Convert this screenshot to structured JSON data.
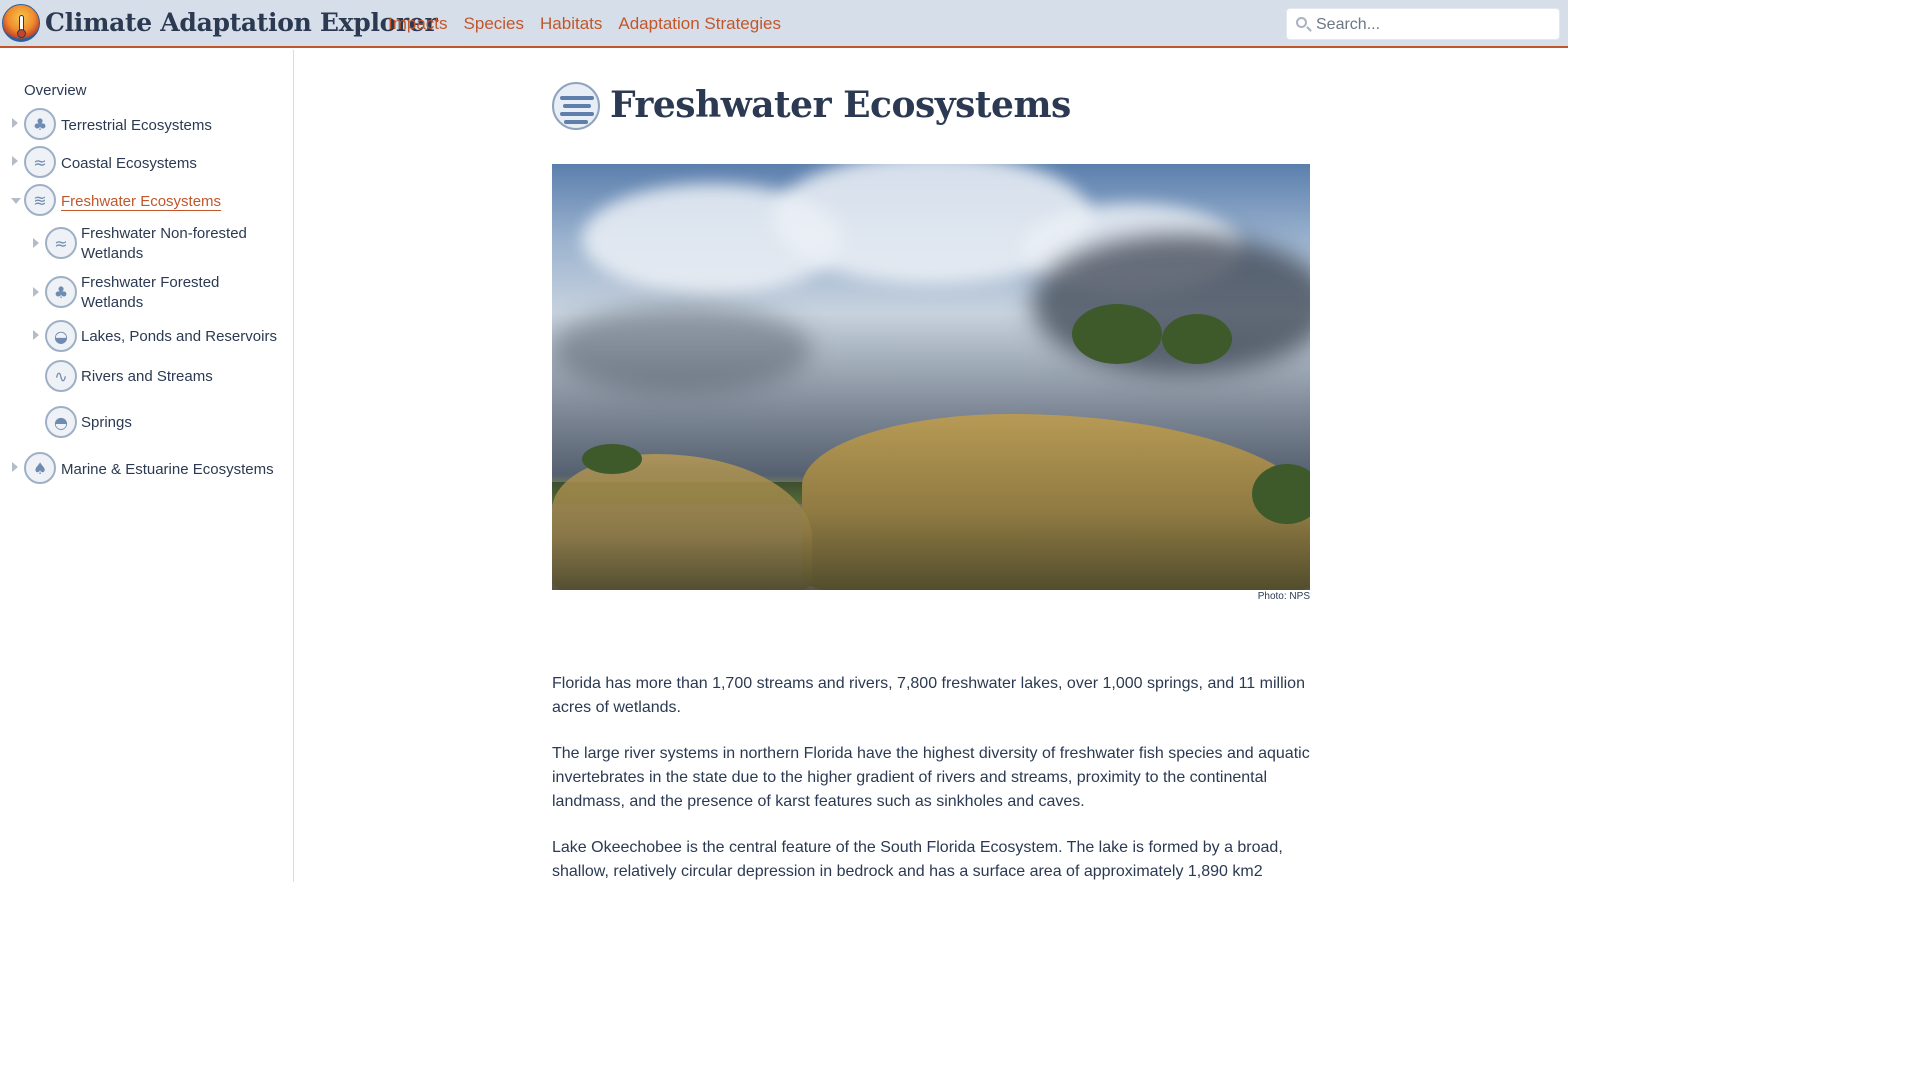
{
  "header": {
    "app_title": "Climate Adaptation Explorer",
    "nav": [
      "Impacts",
      "Species",
      "Habitats",
      "Adaptation Strategies"
    ],
    "search_placeholder": "Search..."
  },
  "sidebar": {
    "overview": "Overview",
    "items": [
      {
        "label": "Terrestrial Ecosystems",
        "icon": "tree-icon",
        "expandable": true,
        "expanded": false,
        "active": false
      },
      {
        "label": "Coastal Ecosystems",
        "icon": "coast-icon",
        "expandable": true,
        "expanded": false,
        "active": false
      },
      {
        "label": "Freshwater Ecosystems",
        "icon": "freshwater-icon",
        "expandable": true,
        "expanded": true,
        "active": true
      },
      {
        "label": "Freshwater Non-forested Wetlands",
        "icon": "wetland-icon",
        "expandable": true,
        "expanded": false,
        "active": false
      },
      {
        "label": "Freshwater Forested Wetlands",
        "icon": "forested-wetland-icon",
        "expandable": true,
        "expanded": false,
        "active": false
      },
      {
        "label": "Lakes, Ponds and Reservoirs",
        "icon": "lake-icon",
        "expandable": true,
        "expanded": false,
        "active": false
      },
      {
        "label": "Rivers and Streams",
        "icon": "river-icon",
        "expandable": false,
        "expanded": false,
        "active": false
      },
      {
        "label": "Springs",
        "icon": "spring-icon",
        "expandable": false,
        "expanded": false,
        "active": false
      },
      {
        "label": "Marine & Estuarine Ecosystems",
        "icon": "palm-icon",
        "expandable": true,
        "expanded": false,
        "active": false
      }
    ],
    "wrapped_labels": {
      "non_forested": [
        "Freshwater Non-forested",
        "Wetlands"
      ],
      "forested": [
        "Freshwater Forested",
        "Wetlands"
      ]
    }
  },
  "main": {
    "title": "Freshwater Ecosystems",
    "photo_caption": "Photo: NPS",
    "paragraphs": [
      "Florida has more than 1,700 streams and rivers, 7,800 freshwater lakes, over 1,000 springs, and 11 million acres of wetlands.",
      "The large river systems in northern Florida have the highest diversity of freshwater fish species and aquatic invertebrates in the state due to the higher gradient of rivers and streams, proximity to the continental landmass, and the presence of karst features such as sinkholes and caves.",
      "Lake Okeechobee is the central feature of the South Florida Ecosystem. The lake is formed by a broad, shallow, relatively circular depression in bedrock and has a surface area of approximately 1,890 km2"
    ]
  },
  "colors": {
    "header_bg": "#d6dfe9",
    "accent": "#c2562b",
    "text": "#2b3a52",
    "icon_blue": "#6f8bb1"
  }
}
